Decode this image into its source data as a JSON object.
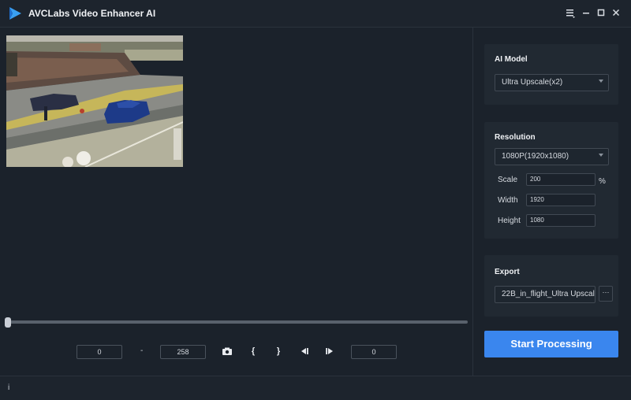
{
  "app": {
    "title": "AVCLabs Video Enhancer AI",
    "window_controls": [
      "menu-icon",
      "minimize-icon",
      "maximize-icon",
      "close-icon"
    ]
  },
  "player": {
    "start_frame": "0",
    "end_frame": "258",
    "range_dash": "-",
    "current_frame": "0",
    "controls": [
      "camera-icon",
      "mark-in-icon",
      "mark-out-icon",
      "prev-frame-icon",
      "next-frame-icon"
    ],
    "mark_in_glyph": "{",
    "mark_out_glyph": "}",
    "progress": 0
  },
  "ai_model": {
    "title": "AI Model",
    "selected": "Ultra Upscale(x2)"
  },
  "resolution": {
    "title": "Resolution",
    "selected": "1080P(1920x1080)",
    "scale_label": "Scale",
    "scale_value": "200",
    "scale_unit": "%",
    "width_label": "Width",
    "width_value": "1920",
    "height_label": "Height",
    "height_value": "1080"
  },
  "export": {
    "title": "Export",
    "path": "22B_in_flight_Ultra Upscal",
    "browse_label": "···"
  },
  "actions": {
    "start_label": "Start Processing"
  },
  "footer": {
    "info_glyph": "i"
  },
  "colors": {
    "accent": "#3a86ee",
    "background": "#1b222b",
    "panel": "#212932"
  }
}
